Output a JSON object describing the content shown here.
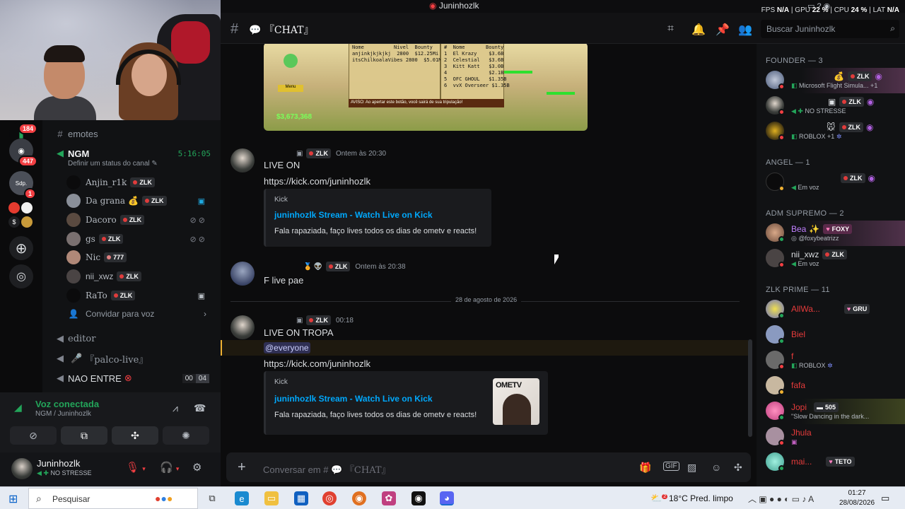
{
  "window": {
    "title": "Juninhozlk",
    "perf": {
      "fps_label": "FPS",
      "fps": "N/A",
      "gpu_label": "GPU",
      "gpu": "22 %",
      "cpu_label": "CPU",
      "cpu": "24 %",
      "lat_label": "LAT",
      "lat": "N/A"
    }
  },
  "servers": {
    "badges": [
      "184",
      "447",
      "1"
    ],
    "labels": [
      "Sdp."
    ],
    "add_icon": "plus-icon",
    "discover_icon": "compass-icon"
  },
  "channels": {
    "emotes": "emotes",
    "voice_channel": {
      "name": "NGM",
      "timer": "5:16:05",
      "status_placeholder": "Definir um status do canal"
    },
    "voice_users": [
      {
        "name": "Anjin_r1k",
        "tag": "ZLK"
      },
      {
        "name": "Da grana",
        "tag": "ZLK"
      },
      {
        "name": "Dacoro",
        "tag": "ZLK"
      },
      {
        "name": "gs",
        "tag": "ZLK"
      },
      {
        "name": "Nic",
        "tag": "777"
      },
      {
        "name": "nii_xwz",
        "tag": "ZLK"
      },
      {
        "name": "RaTo",
        "tag": "ZLK"
      }
    ],
    "invite": "Convidar para voz",
    "editor": "editor",
    "palco": "『palco-live』",
    "nao_entre": "NAO ENTRE",
    "nao_entre_counts": [
      "00",
      "04"
    ]
  },
  "voice_panel": {
    "status": "Voz conectada",
    "sub": "NGM / Juninhozlk"
  },
  "user_panel": {
    "name": "Juninhozlk",
    "status": "NO STRESSE"
  },
  "topbar": {
    "channel_name": "『CHAT』",
    "search_placeholder": "Buscar Juninhozlk"
  },
  "game_embed": {
    "table1": "Nome          Nivel  Bounty\nanjinkjkjkjkj  2800  $12.25Mi\nitsChilkoalaVibes 2800  $5.01Mi",
    "table2": "#  Nome       Bounty\n1  El Krazy    $3.6B\n2  Celestial   $3.6B\n3  Kitt Katt   $3.0B\n4              $2.1B\n5  OFC GHOUL   $1.35B\n6  vvX Overseer $1.35B",
    "warning": "AVISO: Ao apertar este botão, você sairá de sua tripulação!",
    "menu": "Menu",
    "cash": "$3,673,368"
  },
  "messages": [
    {
      "tag": "ZLK",
      "time": "Ontem às 20:30",
      "text": "LIVE ON",
      "link": "https://kick.com/juninhozlk",
      "embed": {
        "provider": "Kick",
        "title": "juninhozlk Stream - Watch Live on Kick",
        "desc": "Fala rapaziada, faço lives todos os dias de ometv e reacts!"
      }
    },
    {
      "tag": "ZLK",
      "time": "Ontem às 20:38",
      "text": "F live pae"
    },
    {
      "date_divider": "28 de agosto de 2026"
    },
    {
      "tag": "ZLK",
      "time": "00:18",
      "text": "LIVE ON TROPA",
      "mention": "@everyone",
      "link": "https://kick.com/juninhozlk",
      "embed": {
        "provider": "Kick",
        "title": "juninhozlk Stream - Watch Live on Kick",
        "desc": "Fala rapaziada, faço lives todos os dias de ometv e reacts!",
        "thumb_text": "OMETV"
      }
    }
  ],
  "composer": {
    "placeholder": "Conversar em #",
    "channel": "『CHAT』"
  },
  "members": {
    "groups": [
      {
        "title": "FOUNDER — 3"
      },
      {
        "title": "ANGEL — 1"
      },
      {
        "title": "ADM SUPREMO — 2"
      },
      {
        "title": "ZLK PRIME — 11"
      }
    ],
    "founder": [
      {
        "name": "",
        "tag": "ZLK",
        "activity": "Microsoft Flight Simula... +1"
      },
      {
        "name": "",
        "tag": "ZLK",
        "activity": "NO STRESSE"
      },
      {
        "name": "",
        "tag": "ZLK",
        "activity": "ROBLOX +1"
      }
    ],
    "angel": [
      {
        "name": "",
        "tag": "ZLK",
        "activity": "Em voz"
      }
    ],
    "adm": [
      {
        "name": "Bea",
        "tag": "FOXY",
        "activity": "@foxybeatrizz"
      },
      {
        "name": "nii_xwz",
        "tag": "ZLK",
        "activity": "Em voz"
      }
    ],
    "prime": [
      {
        "name": "AllWa...",
        "tag": "GRU",
        "activity": ""
      },
      {
        "name": "Biel",
        "tag": "",
        "activity": ""
      },
      {
        "name": "f",
        "tag": "",
        "activity": "ROBLOX"
      },
      {
        "name": "fafa",
        "tag": "",
        "activity": ""
      },
      {
        "name": "Jopi",
        "tag": "505",
        "activity": "\"Slow Dancing in the dark..."
      },
      {
        "name": "Jhula",
        "tag": "",
        "activity": ""
      },
      {
        "name": "mai...",
        "tag": "TETO",
        "activity": ""
      }
    ]
  },
  "taskbar": {
    "search": "Pesquisar",
    "weather": "18°C  Pred. limpo",
    "time": "01:27",
    "date": "28/08/2026",
    "weather_badge": "2"
  },
  "colors": {
    "accent": "#5865f2",
    "link": "#00a8fc",
    "online": "#23a55a",
    "dnd": "#f23f43"
  }
}
